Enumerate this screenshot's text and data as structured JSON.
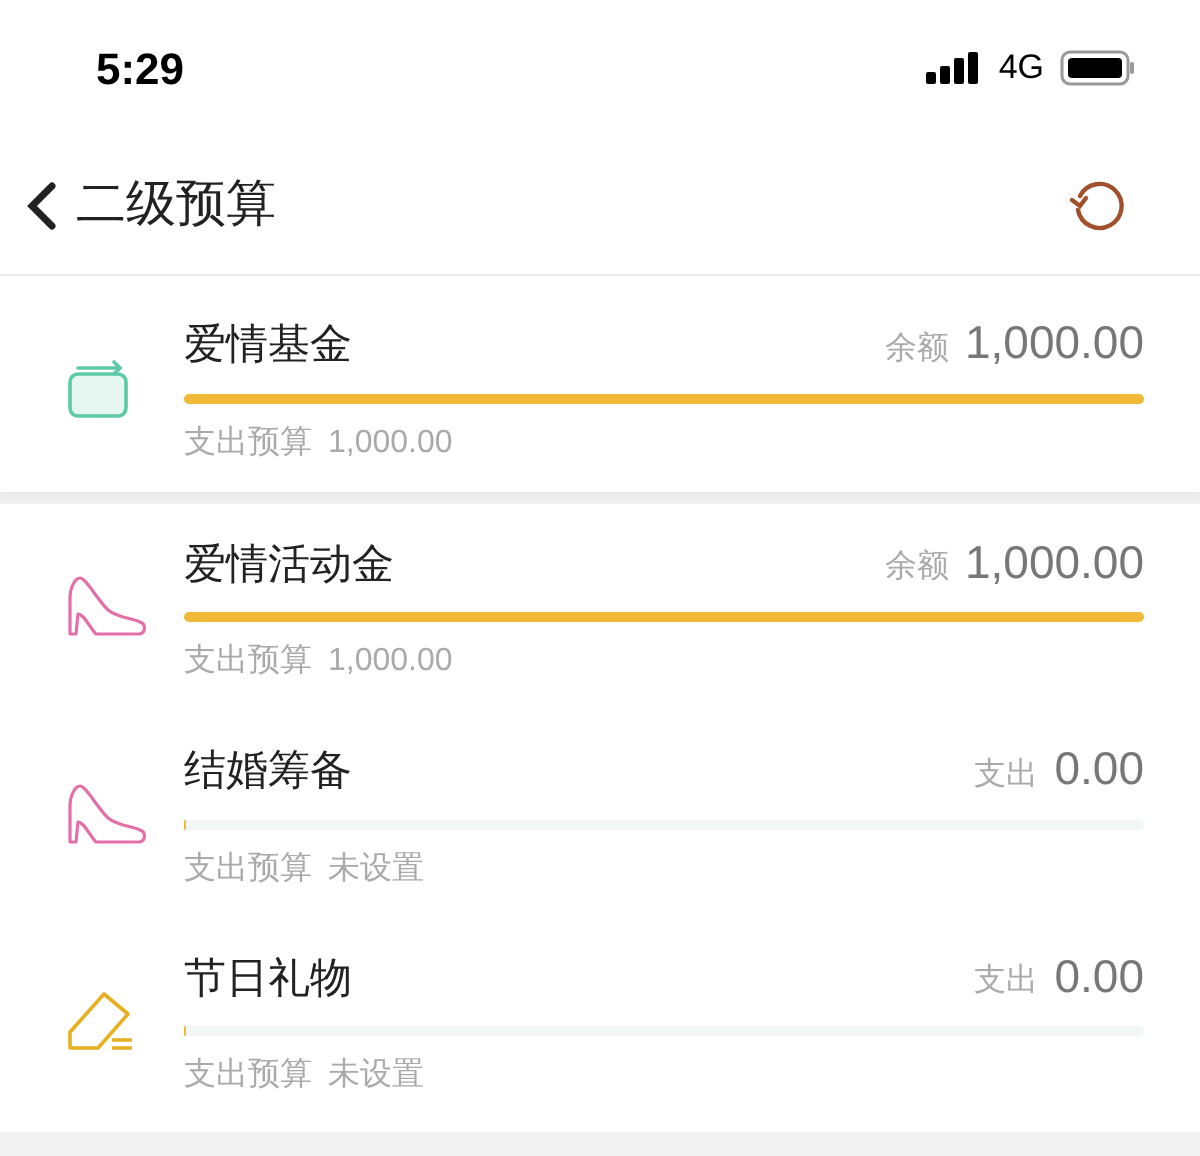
{
  "status_bar": {
    "time": "5:29",
    "network": "4G"
  },
  "header": {
    "title": "二级预算"
  },
  "parent": {
    "kind": "wallet",
    "name": "爱情基金",
    "amount_label": "余额",
    "amount": "1,000.00",
    "level": 1,
    "budget_label": "支出预算",
    "budget": "1,000.00"
  },
  "children": [
    {
      "kind": "shoe",
      "name": "爱情活动金",
      "amount_label": "余额",
      "amount": "1,000.00",
      "level": 1,
      "budget_label": "支出预算",
      "budget": "1,000.00"
    },
    {
      "kind": "shoe",
      "name": "结婚筹备",
      "amount_label": "支出",
      "amount": "0.00",
      "level": 0,
      "budget_label": "支出预算",
      "budget": "未设置"
    },
    {
      "kind": "eraser",
      "name": "节日礼物",
      "amount_label": "支出",
      "amount": "0.00",
      "level": 0,
      "budget_label": "支出预算",
      "budget": "未设置"
    }
  ]
}
